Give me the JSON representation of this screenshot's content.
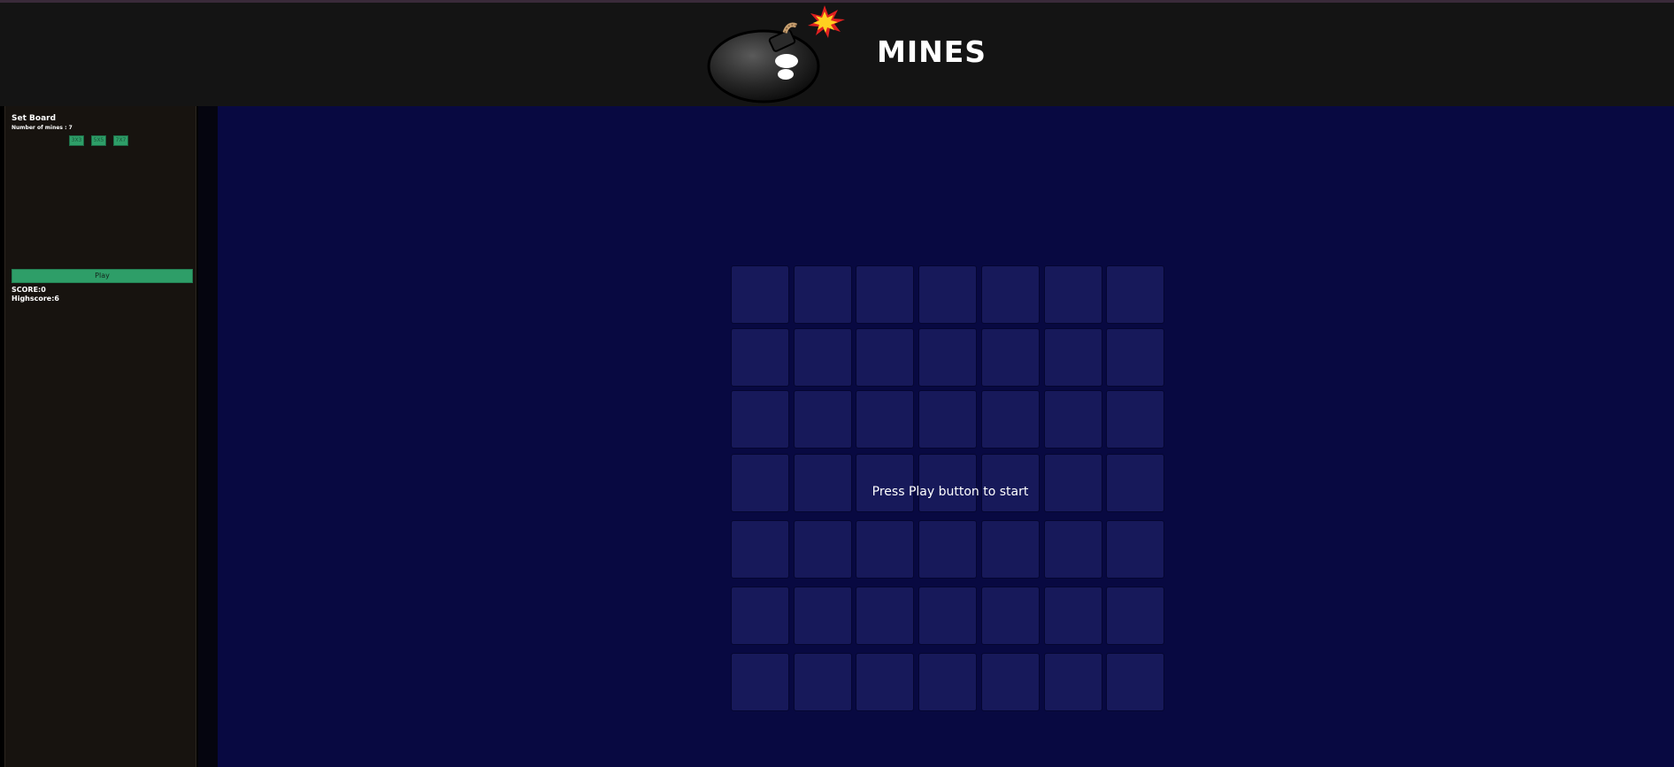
{
  "header": {
    "title": "MINES",
    "logo_icon": "bomb-icon"
  },
  "sidebar": {
    "heading": "Set Board",
    "mines_label": "Number of mines : 7",
    "size_buttons": [
      "3X3",
      "5X5",
      "7X7"
    ],
    "play_label": "Play",
    "score_label": "SCORE:0",
    "highscore_label": "Highscore:6"
  },
  "board": {
    "rows": 7,
    "cols": 7,
    "message": "Press Play button to start"
  },
  "colors": {
    "accent_green": "#2e9e68",
    "board_background": "#080941",
    "cell": "#17195a"
  }
}
